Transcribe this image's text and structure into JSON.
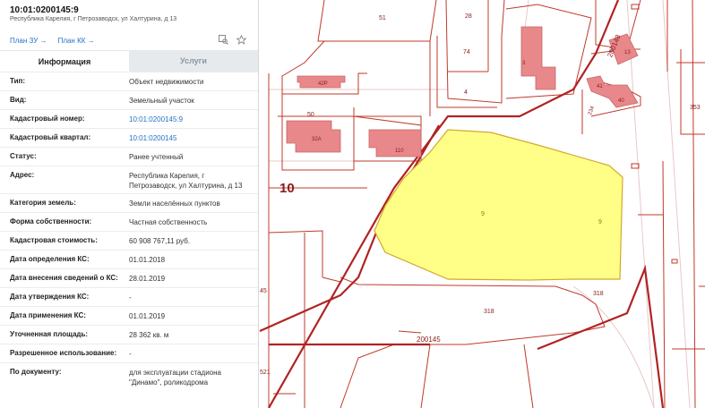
{
  "map": {
    "labels": {
      "p51": "51",
      "p28": "28",
      "p74": "74",
      "p4": "4",
      "p50": "50",
      "p10": "10",
      "p200148": "200148",
      "p2": "2",
      "p353": "353",
      "p9a": "9",
      "p9b": "9",
      "p318a": "318",
      "p318b": "318",
      "p200145": "200145",
      "p45": "45",
      "p521": "521",
      "p234": "234",
      "b42r": "42Р",
      "b32a": "32А",
      "b110": "110",
      "b3": "3",
      "b13": "13",
      "b40": "40",
      "b41": "41"
    },
    "colors": {
      "parcel_border": "#c0392b",
      "highlight_fill": "#ffff88",
      "highlight_border": "#d4a72c",
      "building_fill": "#e8888a",
      "quarter_border": "#b22222"
    }
  },
  "panel": {
    "title": "10:01:0200145:9",
    "address": "Республика Карелия, г Петрозаводск, ул Халтурина, д 13",
    "links": {
      "plan_zu": "План ЗУ →",
      "plan_kk": "План КК →"
    },
    "tabs": {
      "info": "Информация",
      "services": "Услуги"
    },
    "rows": [
      {
        "k": "Тип:",
        "v": "Объект недвижимости"
      },
      {
        "k": "Вид:",
        "v": "Земельный участок"
      },
      {
        "k": "Кадастровый номер:",
        "v": "10:01:0200145:9"
      },
      {
        "k": "Кадастровый квартал:",
        "v": "10:01:0200145"
      },
      {
        "k": "Статус:",
        "v": "Ранее учтенный"
      },
      {
        "k": "Адрес:",
        "v": "Республика Карелия, г Петрозаводск, ул Халтурина, д 13"
      },
      {
        "k": "Категория земель:",
        "v": "Земли населённых пунктов"
      },
      {
        "k": "Форма собственности:",
        "v": "Частная собственность"
      },
      {
        "k": "Кадастровая стоимость:",
        "v": "60 908 767,11 руб."
      },
      {
        "k": "Дата определения КС:",
        "v": "01.01.2018"
      },
      {
        "k": "Дата внесения сведений о КС:",
        "v": "28.01.2019"
      },
      {
        "k": "Дата утверждения КС:",
        "v": "-"
      },
      {
        "k": "Дата применения КС:",
        "v": "01.01.2019"
      },
      {
        "k": "Уточненная площадь:",
        "v": "28 362 кв. м"
      },
      {
        "k": "Разрешенное использование:",
        "v": "-"
      },
      {
        "k": "По документу:",
        "v": "для эксплуатации стадиона \"Динамо\", роликодрома"
      }
    ]
  }
}
